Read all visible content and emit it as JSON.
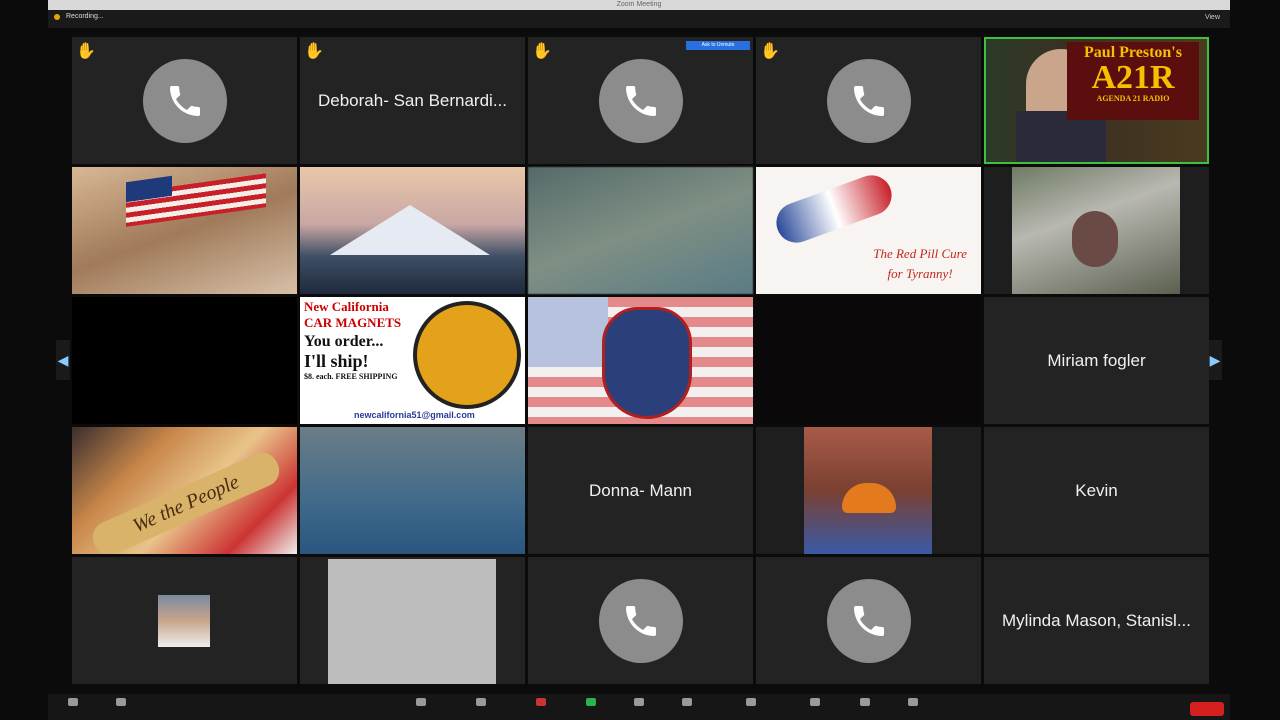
{
  "window": {
    "title": "Zoom Meeting"
  },
  "topbar": {
    "recording_label": "Recording...",
    "view_label": "View"
  },
  "host_tag": "Ask to Unmute",
  "broadcast": {
    "line1": "Paul Preston's",
    "line2": "A21R",
    "line3": "AGENDA 21 RADIO"
  },
  "participants": {
    "p2": "Deborah- San Bernardi...",
    "p15": "Miriam fogler",
    "p18": "Donna- Mann",
    "p20": "Kevin",
    "p25": "Mylinda Mason, Stanisl..."
  },
  "magnet": {
    "line1": "New California",
    "line2": "CAR MAGNETS",
    "line3": "You order...",
    "line4": "I'll ship!",
    "line5": "$8. each. FREE SHIPPING",
    "email": "newcalifornia51@gmail.com"
  },
  "redpill": {
    "line1": "The Red Pill Cure",
    "line2": "for Tyranny!"
  },
  "constitution_text": "We the People",
  "icons": {
    "raised_hand": "raised-hand-icon",
    "phone": "phone-icon"
  },
  "colors": {
    "tile_bg": "#232323",
    "phone_circle": "#8c8c8c",
    "end_button": "#d62020",
    "brand_gold": "#f6c000"
  }
}
